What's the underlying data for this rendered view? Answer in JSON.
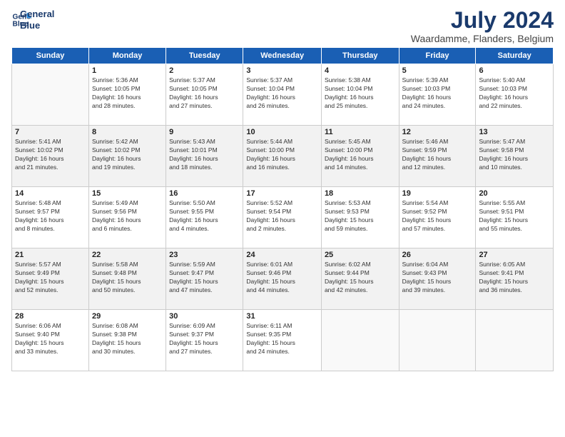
{
  "logo": {
    "line1": "General",
    "line2": "Blue"
  },
  "title": "July 2024",
  "location": "Waardamme, Flanders, Belgium",
  "days_of_week": [
    "Sunday",
    "Monday",
    "Tuesday",
    "Wednesday",
    "Thursday",
    "Friday",
    "Saturday"
  ],
  "weeks": [
    [
      {
        "day": "",
        "info": ""
      },
      {
        "day": "1",
        "info": "Sunrise: 5:36 AM\nSunset: 10:05 PM\nDaylight: 16 hours\nand 28 minutes."
      },
      {
        "day": "2",
        "info": "Sunrise: 5:37 AM\nSunset: 10:05 PM\nDaylight: 16 hours\nand 27 minutes."
      },
      {
        "day": "3",
        "info": "Sunrise: 5:37 AM\nSunset: 10:04 PM\nDaylight: 16 hours\nand 26 minutes."
      },
      {
        "day": "4",
        "info": "Sunrise: 5:38 AM\nSunset: 10:04 PM\nDaylight: 16 hours\nand 25 minutes."
      },
      {
        "day": "5",
        "info": "Sunrise: 5:39 AM\nSunset: 10:03 PM\nDaylight: 16 hours\nand 24 minutes."
      },
      {
        "day": "6",
        "info": "Sunrise: 5:40 AM\nSunset: 10:03 PM\nDaylight: 16 hours\nand 22 minutes."
      }
    ],
    [
      {
        "day": "7",
        "info": "Sunrise: 5:41 AM\nSunset: 10:02 PM\nDaylight: 16 hours\nand 21 minutes."
      },
      {
        "day": "8",
        "info": "Sunrise: 5:42 AM\nSunset: 10:02 PM\nDaylight: 16 hours\nand 19 minutes."
      },
      {
        "day": "9",
        "info": "Sunrise: 5:43 AM\nSunset: 10:01 PM\nDaylight: 16 hours\nand 18 minutes."
      },
      {
        "day": "10",
        "info": "Sunrise: 5:44 AM\nSunset: 10:00 PM\nDaylight: 16 hours\nand 16 minutes."
      },
      {
        "day": "11",
        "info": "Sunrise: 5:45 AM\nSunset: 10:00 PM\nDaylight: 16 hours\nand 14 minutes."
      },
      {
        "day": "12",
        "info": "Sunrise: 5:46 AM\nSunset: 9:59 PM\nDaylight: 16 hours\nand 12 minutes."
      },
      {
        "day": "13",
        "info": "Sunrise: 5:47 AM\nSunset: 9:58 PM\nDaylight: 16 hours\nand 10 minutes."
      }
    ],
    [
      {
        "day": "14",
        "info": "Sunrise: 5:48 AM\nSunset: 9:57 PM\nDaylight: 16 hours\nand 8 minutes."
      },
      {
        "day": "15",
        "info": "Sunrise: 5:49 AM\nSunset: 9:56 PM\nDaylight: 16 hours\nand 6 minutes."
      },
      {
        "day": "16",
        "info": "Sunrise: 5:50 AM\nSunset: 9:55 PM\nDaylight: 16 hours\nand 4 minutes."
      },
      {
        "day": "17",
        "info": "Sunrise: 5:52 AM\nSunset: 9:54 PM\nDaylight: 16 hours\nand 2 minutes."
      },
      {
        "day": "18",
        "info": "Sunrise: 5:53 AM\nSunset: 9:53 PM\nDaylight: 15 hours\nand 59 minutes."
      },
      {
        "day": "19",
        "info": "Sunrise: 5:54 AM\nSunset: 9:52 PM\nDaylight: 15 hours\nand 57 minutes."
      },
      {
        "day": "20",
        "info": "Sunrise: 5:55 AM\nSunset: 9:51 PM\nDaylight: 15 hours\nand 55 minutes."
      }
    ],
    [
      {
        "day": "21",
        "info": "Sunrise: 5:57 AM\nSunset: 9:49 PM\nDaylight: 15 hours\nand 52 minutes."
      },
      {
        "day": "22",
        "info": "Sunrise: 5:58 AM\nSunset: 9:48 PM\nDaylight: 15 hours\nand 50 minutes."
      },
      {
        "day": "23",
        "info": "Sunrise: 5:59 AM\nSunset: 9:47 PM\nDaylight: 15 hours\nand 47 minutes."
      },
      {
        "day": "24",
        "info": "Sunrise: 6:01 AM\nSunset: 9:46 PM\nDaylight: 15 hours\nand 44 minutes."
      },
      {
        "day": "25",
        "info": "Sunrise: 6:02 AM\nSunset: 9:44 PM\nDaylight: 15 hours\nand 42 minutes."
      },
      {
        "day": "26",
        "info": "Sunrise: 6:04 AM\nSunset: 9:43 PM\nDaylight: 15 hours\nand 39 minutes."
      },
      {
        "day": "27",
        "info": "Sunrise: 6:05 AM\nSunset: 9:41 PM\nDaylight: 15 hours\nand 36 minutes."
      }
    ],
    [
      {
        "day": "28",
        "info": "Sunrise: 6:06 AM\nSunset: 9:40 PM\nDaylight: 15 hours\nand 33 minutes."
      },
      {
        "day": "29",
        "info": "Sunrise: 6:08 AM\nSunset: 9:38 PM\nDaylight: 15 hours\nand 30 minutes."
      },
      {
        "day": "30",
        "info": "Sunrise: 6:09 AM\nSunset: 9:37 PM\nDaylight: 15 hours\nand 27 minutes."
      },
      {
        "day": "31",
        "info": "Sunrise: 6:11 AM\nSunset: 9:35 PM\nDaylight: 15 hours\nand 24 minutes."
      },
      {
        "day": "",
        "info": ""
      },
      {
        "day": "",
        "info": ""
      },
      {
        "day": "",
        "info": ""
      }
    ]
  ]
}
